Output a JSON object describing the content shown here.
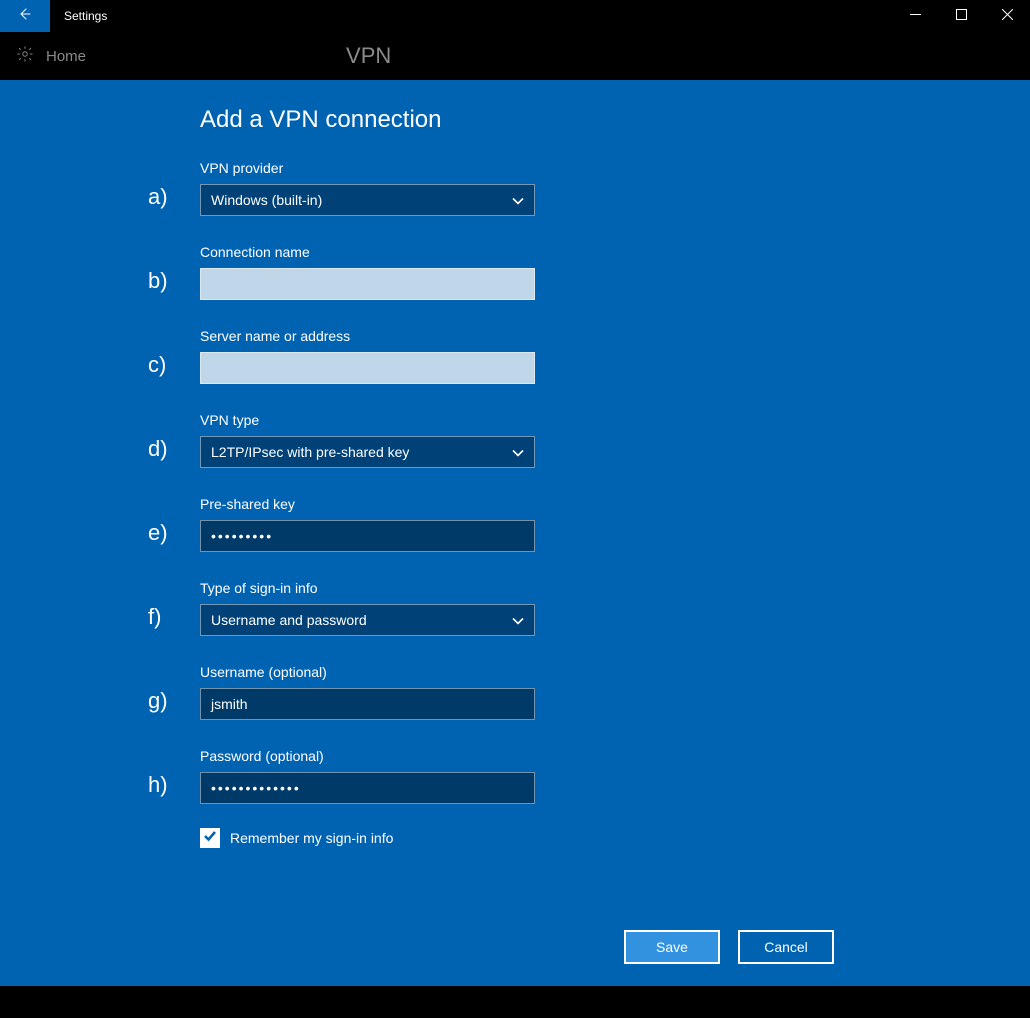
{
  "titlebar": {
    "title": "Settings"
  },
  "subheader": {
    "home": "Home",
    "section": "VPN"
  },
  "heading": "Add a VPN connection",
  "fields": {
    "provider": {
      "marker": "a)",
      "label": "VPN provider",
      "value": "Windows (built-in)"
    },
    "conn_name": {
      "marker": "b)",
      "label": "Connection name",
      "value": ""
    },
    "server": {
      "marker": "c)",
      "label": "Server name or address",
      "value": ""
    },
    "vpn_type": {
      "marker": "d)",
      "label": "VPN type",
      "value": "L2TP/IPsec with pre-shared key"
    },
    "psk": {
      "marker": "e)",
      "label": "Pre-shared key",
      "value": "•••••••••"
    },
    "signin": {
      "marker": "f)",
      "label": "Type of sign-in info",
      "value": "Username and password"
    },
    "username": {
      "marker": "g)",
      "label": "Username (optional)",
      "value": "jsmith"
    },
    "password": {
      "marker": "h)",
      "label": "Password (optional)",
      "value": "•••••••••••••"
    }
  },
  "remember": {
    "label": "Remember my sign-in info",
    "checked": true
  },
  "buttons": {
    "save": "Save",
    "cancel": "Cancel"
  }
}
